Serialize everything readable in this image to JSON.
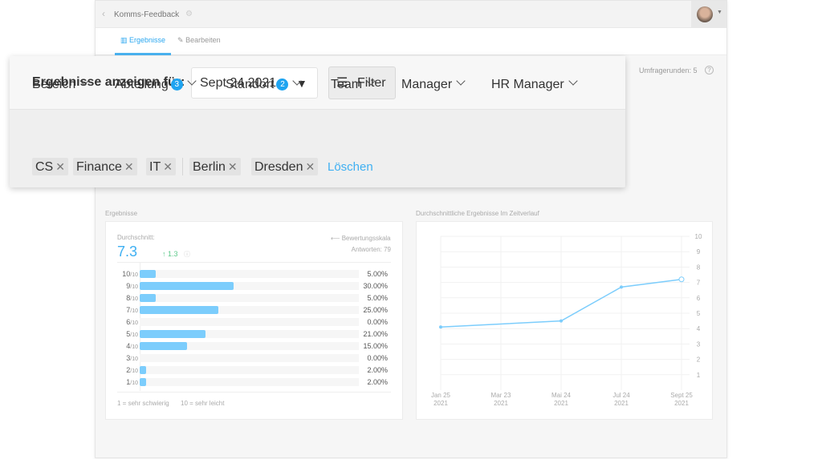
{
  "header": {
    "title": "Komms-Feedback",
    "back_icon": "chevron-left-icon",
    "settings_icon": "gear-icon",
    "avatar": "user-avatar"
  },
  "tabs": [
    {
      "label": "Ergebnisse",
      "icon": "bar-chart-icon",
      "active": true
    },
    {
      "label": "Bearbeiten",
      "icon": "pencil-icon",
      "active": false
    }
  ],
  "survey_rounds": "Umfragerunden: 5",
  "filter_panel": {
    "show_for_label": "Ergebnisse anzeigen für:",
    "date_value": "Sept 24 2021",
    "filter_button": "Filter",
    "dropdowns": [
      {
        "label": "Bereich",
        "badge": null
      },
      {
        "label": "Abteilung",
        "badge": "3"
      },
      {
        "label": "Standort",
        "badge": "2"
      },
      {
        "label": "Team",
        "badge": null
      },
      {
        "label": "Manager",
        "badge": null
      },
      {
        "label": "HR Manager",
        "badge": null
      }
    ],
    "chips_department": [
      "CS",
      "Finance",
      "IT"
    ],
    "chips_location": [
      "Berlin",
      "Dresden"
    ],
    "clear_label": "Löschen"
  },
  "results": {
    "section_title": "Ergebnisse",
    "avg_label": "Durchschnitt:",
    "avg_value": "7.3",
    "delta": "1.3",
    "scale_link": "Bewertungsskala",
    "responses": "Antworten: 79",
    "rows": [
      {
        "score": "10",
        "of": "/10",
        "pct": 5,
        "pct_label": "5.00%"
      },
      {
        "score": "9",
        "of": "/10",
        "pct": 30,
        "pct_label": "30.00%"
      },
      {
        "score": "8",
        "of": "/10",
        "pct": 5,
        "pct_label": "5.00%"
      },
      {
        "score": "7",
        "of": "/10",
        "pct": 25,
        "pct_label": "25.00%"
      },
      {
        "score": "6",
        "of": "/10",
        "pct": 0,
        "pct_label": "0.00%"
      },
      {
        "score": "5",
        "of": "/10",
        "pct": 21,
        "pct_label": "21.00%"
      },
      {
        "score": "4",
        "of": "/10",
        "pct": 15,
        "pct_label": "15.00%"
      },
      {
        "score": "3",
        "of": "/10",
        "pct": 0,
        "pct_label": "0.00%"
      },
      {
        "score": "2",
        "of": "/10",
        "pct": 2,
        "pct_label": "2.00%"
      },
      {
        "score": "1",
        "of": "/10",
        "pct": 2,
        "pct_label": "2.00%"
      }
    ],
    "legend_low": "1 = sehr schwierig",
    "legend_high": "10 = sehr leicht",
    "bar_color": "#7ccdfc",
    "accent": "#1fa4f0",
    "delta_color": "#5cc98a"
  },
  "chart_data": {
    "type": "line",
    "title": "Durchschnittliche Ergebnisse Im Zeitverlauf",
    "x_ticks": [
      [
        "Jan 25",
        "2021"
      ],
      [
        "Mar 23",
        "2021"
      ],
      [
        "Mai 24",
        "2021"
      ],
      [
        "Jul 24",
        "2021"
      ],
      [
        "Sept 25",
        "2021"
      ]
    ],
    "y_ticks": [
      "1",
      "2",
      "3",
      "4",
      "5",
      "6",
      "7",
      "8",
      "9",
      "10"
    ],
    "ylim": [
      0,
      10
    ],
    "y_axis": "right",
    "grid": true,
    "points": [
      {
        "x": "Jan 25 2021",
        "y": 4.1
      },
      {
        "x": "Mai 24 2021",
        "y": 4.5
      },
      {
        "x": "Jul 24 2021",
        "y": 6.7
      },
      {
        "x": "Sept 25 2021",
        "y": 7.2
      }
    ],
    "color": "#7ccdfc"
  }
}
